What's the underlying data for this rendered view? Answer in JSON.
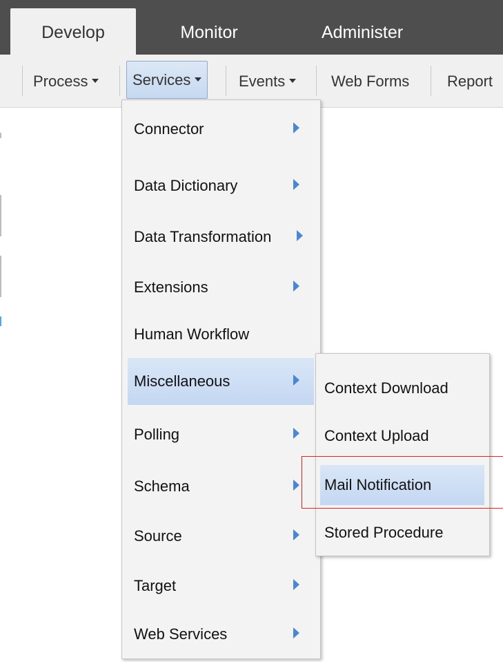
{
  "top_tabs": {
    "develop": "Develop",
    "monitor": "Monitor",
    "administer": "Administer",
    "active": "Develop"
  },
  "nav": {
    "process": "Process",
    "services": "Services",
    "events": "Events",
    "web_forms": "Web Forms",
    "reports": "Report"
  },
  "services_menu": {
    "items": [
      {
        "label": "Connector",
        "has_submenu": true
      },
      {
        "label": "Data Dictionary",
        "has_submenu": true
      },
      {
        "label": "Data Transformation",
        "has_submenu": true
      },
      {
        "label": "Extensions",
        "has_submenu": true
      },
      {
        "label": "Human Workflow",
        "has_submenu": false
      },
      {
        "label": "Miscellaneous",
        "has_submenu": true,
        "highlighted": true
      },
      {
        "label": "Polling",
        "has_submenu": true
      },
      {
        "label": "Schema",
        "has_submenu": true
      },
      {
        "label": "Source",
        "has_submenu": true
      },
      {
        "label": "Target",
        "has_submenu": true
      },
      {
        "label": "Web Services",
        "has_submenu": true
      }
    ]
  },
  "misc_submenu": {
    "items": [
      {
        "label": "Context Download"
      },
      {
        "label": "Context Upload"
      },
      {
        "label": "Mail Notification",
        "highlighted": true
      },
      {
        "label": "Stored Procedure"
      }
    ]
  },
  "colors": {
    "topbar": "#4e4e4e",
    "navbar": "#f0f0f0",
    "highlight": "#c9dbf3",
    "submenu_arrow": "#4a86d4",
    "annotation": "#e02020"
  },
  "icons": {
    "caret": "caret-down-icon",
    "submenu_arrow": "chevron-right-icon"
  }
}
